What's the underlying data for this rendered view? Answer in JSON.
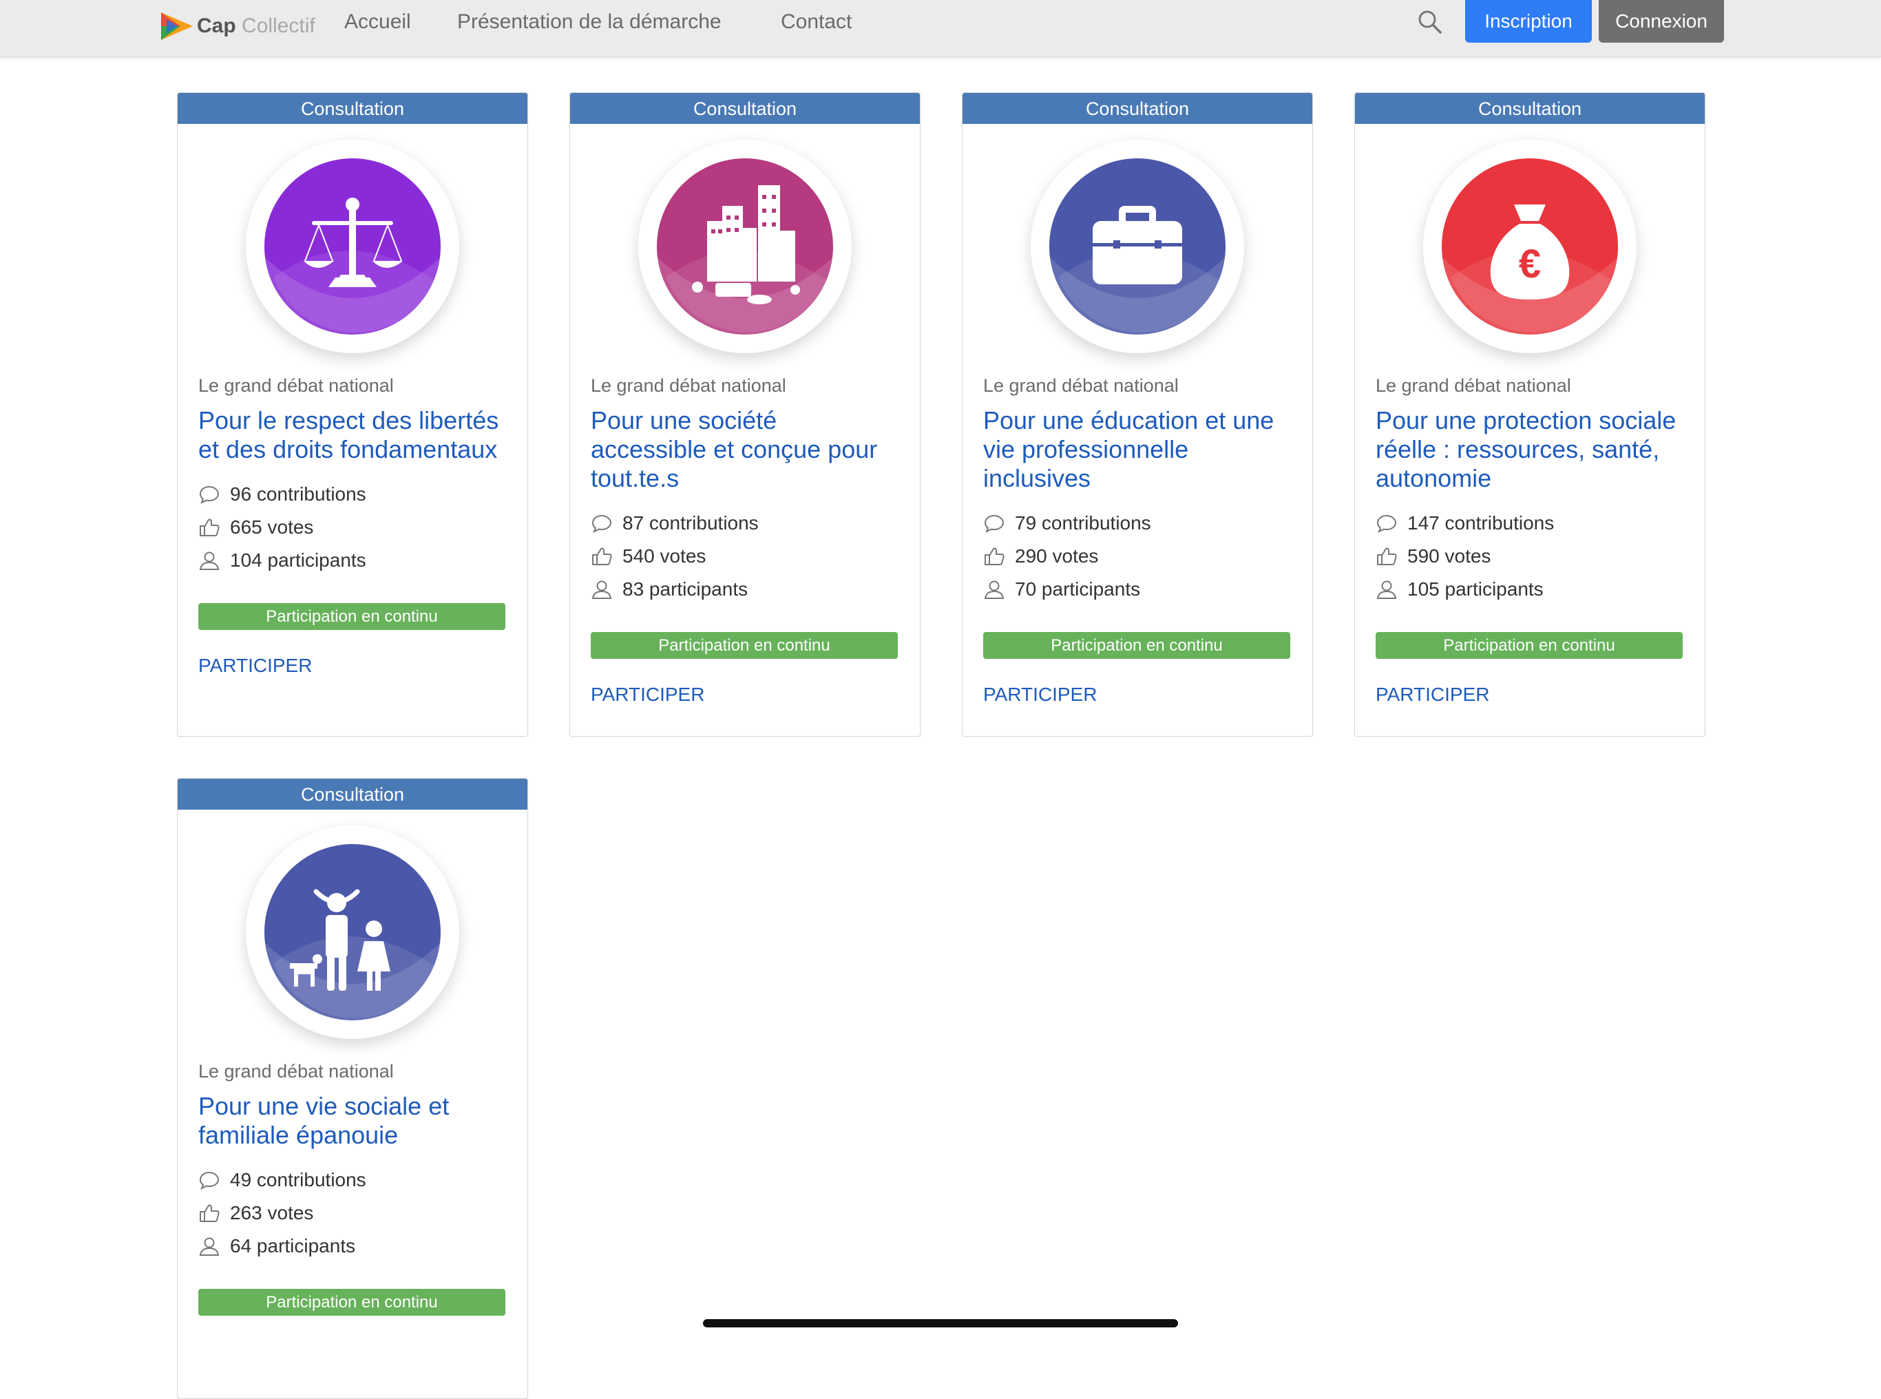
{
  "nav": {
    "logo": {
      "word1": "Cap",
      "word2": "Collectif"
    },
    "links": [
      "Accueil",
      "Présentation de la démarche",
      "Contact"
    ],
    "inscription_label": "Inscription",
    "connexion_label": "Connexion"
  },
  "projects": [
    {
      "type": "Consultation",
      "organizer": "Le grand débat national",
      "title": "Pour le respect des libertés et des droits fondamentaux",
      "contributions": "96 contributions",
      "votes": "665 votes",
      "participants": "104 participants",
      "status": "Participation en continu",
      "cta": "PARTICIPER",
      "icon": "scales-of-justice-icon",
      "color": "#8a2bd8"
    },
    {
      "type": "Consultation",
      "organizer": "Le grand débat national",
      "title": "Pour une société accessible et conçue pour tout.te.s",
      "contributions": "87 contributions",
      "votes": "540 votes",
      "participants": "83 participants",
      "status": "Participation en continu",
      "cta": "PARTICIPER",
      "icon": "city-icon",
      "color": "#b53a7f"
    },
    {
      "type": "Consultation",
      "organizer": "Le grand débat national",
      "title": "Pour une éducation et une vie professionnelle inclusives",
      "contributions": "79 contributions",
      "votes": "290 votes",
      "participants": "70 participants",
      "status": "Participation en continu",
      "cta": "PARTICIPER",
      "icon": "briefcase-icon",
      "color": "#4b57a8"
    },
    {
      "type": "Consultation",
      "organizer": "Le grand débat national",
      "title": "Pour une protection sociale réelle : ressources, santé, autonomie",
      "contributions": "147 contributions",
      "votes": "590 votes",
      "participants": "105 participants",
      "status": "Participation en continu",
      "cta": "PARTICIPER",
      "icon": "money-bag-icon",
      "color": "#e9353d"
    },
    {
      "type": "Consultation",
      "organizer": "Le grand débat national",
      "title": "Pour une vie sociale et familiale épanouie",
      "contributions": "49 contributions",
      "votes": "263 votes",
      "participants": "64 participants",
      "status": "Participation en continu",
      "cta": "",
      "icon": "family-icon",
      "color": "#4b57a8"
    }
  ]
}
